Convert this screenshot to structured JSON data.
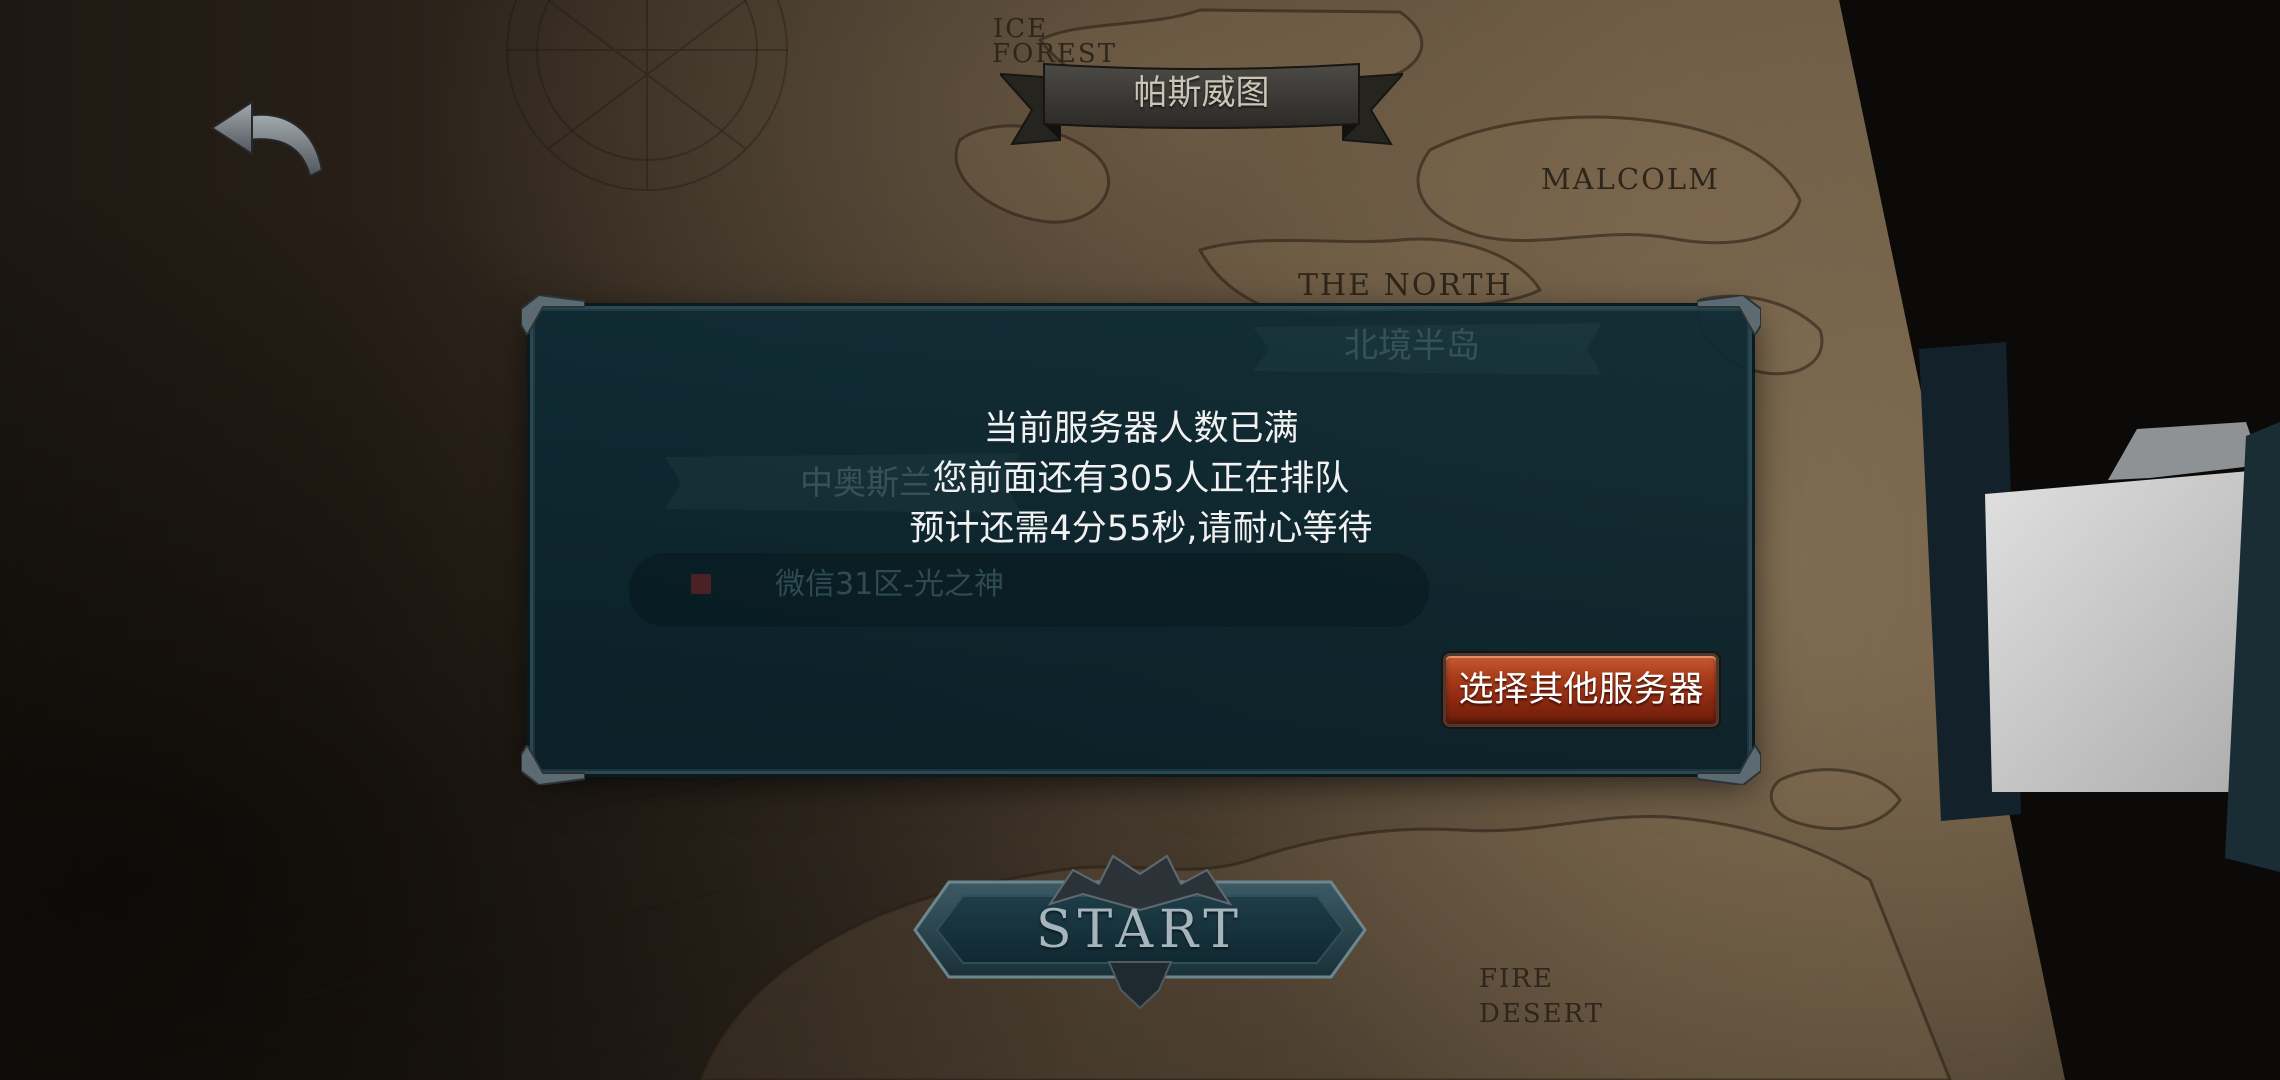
{
  "map": {
    "title": "帕斯威图",
    "region_labels": {
      "ice_forest": [
        "ICE",
        "FOREST"
      ],
      "malcolm": "MALCOLM",
      "the_north": "THE NORTH",
      "fire_desert": [
        "FIRE",
        "DESERT"
      ]
    },
    "faded_labels": {
      "north_peninsula": "北境半岛",
      "central_region": "中奥斯兰",
      "server_name": "微信31区-光之神"
    }
  },
  "back_button": {
    "icon": "back-arrow-icon"
  },
  "queue_dialog": {
    "status_line": "当前服务器人数已满",
    "position_line": {
      "prefix": "您前面还有",
      "count": 305,
      "suffix": "人正在排队"
    },
    "wait_line": {
      "prefix": "预计还需",
      "time": "4分55秒",
      "suffix": ",请耐心等待"
    },
    "choose_server_label": "选择其他服务器"
  },
  "start_button": {
    "label": "START",
    "icon": "winged-crest-icon"
  },
  "theme": {
    "dialog_text": "#f1f1f1",
    "button_red": "#a83c1a",
    "map_ink": "#2e251b",
    "start_text": "#a6b4bb",
    "faded_label": "#365159"
  }
}
